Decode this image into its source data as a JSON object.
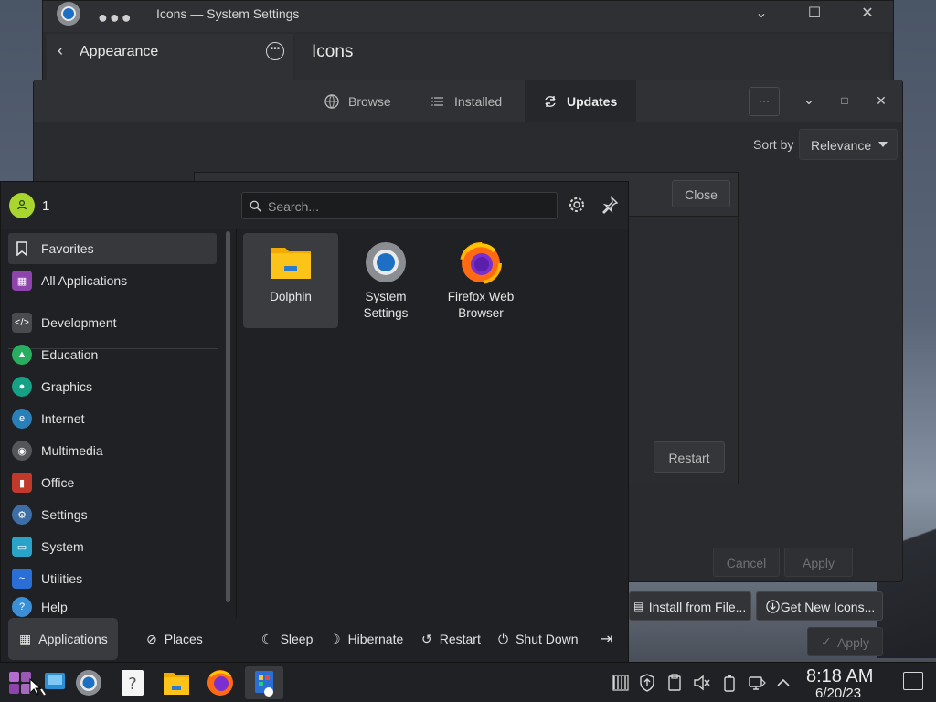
{
  "settings_window": {
    "title": "Icons — System Settings",
    "nav_label": "Appearance",
    "page_title": "Icons",
    "install_from_file": "Install from File...",
    "get_new_icons": "Get New Icons...",
    "apply": "Apply"
  },
  "discover": {
    "tabs": [
      {
        "label": "Browse",
        "icon": "globe-icon"
      },
      {
        "label": "Installed",
        "icon": "list-icon"
      },
      {
        "label": "Updates",
        "icon": "refresh-icon"
      }
    ],
    "active_tab": "Updates",
    "sort_label": "Sort by",
    "sort_value": "Relevance",
    "dialog_close": "Close",
    "dialog_restart": "Restart",
    "cancel": "Cancel",
    "apply": "Apply"
  },
  "launcher": {
    "username": "1",
    "search_placeholder": "Search...",
    "sidebar": [
      {
        "label": "Favorites",
        "icon": "bookmark-icon",
        "color": "#202124"
      },
      {
        "label": "All Applications",
        "icon": "grid-icon",
        "color": "#8e44ad"
      },
      {
        "label": "Development",
        "icon": "code-icon",
        "color": "#4a4b4f"
      },
      {
        "label": "Education",
        "icon": "graduation-icon",
        "color": "#27ae60"
      },
      {
        "label": "Graphics",
        "icon": "palette-icon",
        "color": "#16a085"
      },
      {
        "label": "Internet",
        "icon": "globe-icon",
        "color": "#2980b9"
      },
      {
        "label": "Multimedia",
        "icon": "speaker-icon",
        "color": "#555659"
      },
      {
        "label": "Office",
        "icon": "office-icon",
        "color": "#c0392b"
      },
      {
        "label": "Settings",
        "icon": "gear-icon",
        "color": "#3d6fa6"
      },
      {
        "label": "System",
        "icon": "monitor-icon",
        "color": "#2aa3c9"
      },
      {
        "label": "Utilities",
        "icon": "utilities-icon",
        "color": "#2a6fd6"
      },
      {
        "label": "Help",
        "icon": "help-icon",
        "color": "#3b8fd6"
      }
    ],
    "apps": [
      {
        "line1": "Dolphin",
        "line2": "",
        "icon": "folder-icon"
      },
      {
        "line1": "System",
        "line2": "Settings",
        "icon": "settings-app-icon"
      },
      {
        "line1": "Firefox Web",
        "line2": "Browser",
        "icon": "firefox-icon"
      }
    ],
    "footer": {
      "applications": "Applications",
      "places": "Places",
      "sleep": "Sleep",
      "hibernate": "Hibernate",
      "restart": "Restart",
      "shutdown": "Shut Down"
    }
  },
  "taskbar": {
    "time": "8:18 AM",
    "date": "6/20/23"
  }
}
